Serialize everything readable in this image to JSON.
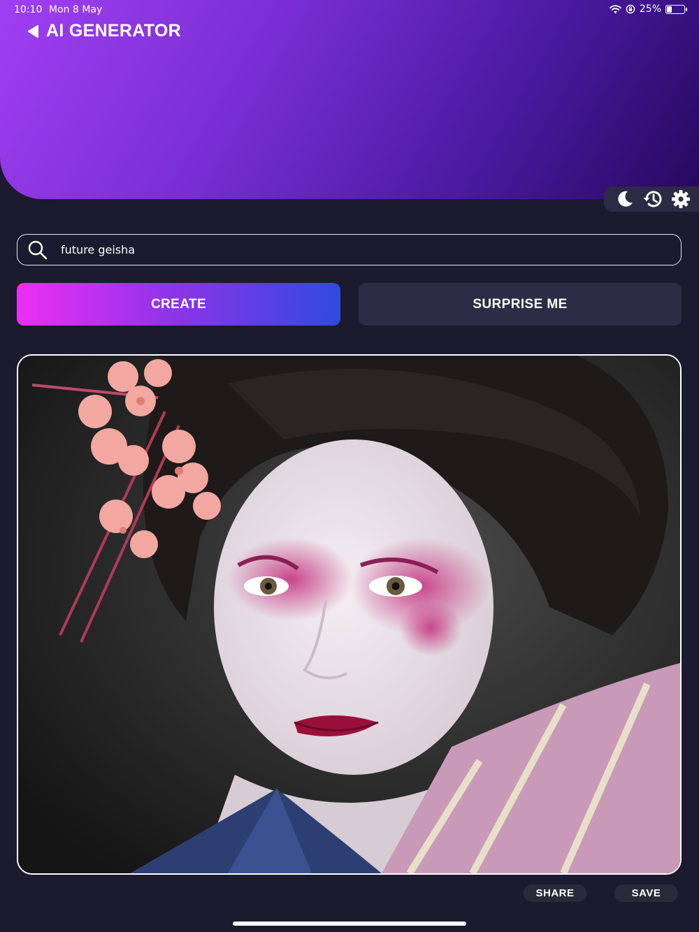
{
  "status_bar": {
    "time": "10:10",
    "date": "Mon 8 May",
    "battery_text": "25%",
    "battery_level": 0.25
  },
  "header": {
    "title": "AI GENERATOR",
    "gradient": [
      "#a03ff0",
      "#26085e"
    ]
  },
  "toolbar": {
    "icons": [
      "moon-icon",
      "history-icon",
      "gear-icon"
    ]
  },
  "search": {
    "value": "future geisha",
    "placeholder": ""
  },
  "buttons": {
    "create_label": "CREATE",
    "surprise_label": "SURPRISE ME"
  },
  "image": {
    "description_icon": "generated-image"
  },
  "actions": {
    "share_label": "SHARE",
    "save_label": "SAVE"
  },
  "colors": {
    "background": "#1c1a2e",
    "create_gradient_start": "#ec2ff4",
    "create_gradient_end": "#2f4bdd",
    "secondary_button": "#2e2b45"
  }
}
